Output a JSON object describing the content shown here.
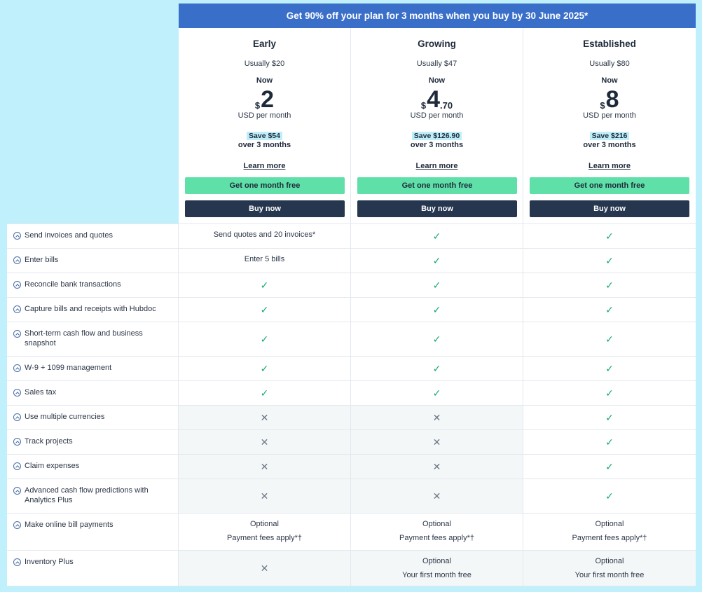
{
  "banner": "Get 90% off your plan for 3 months when you buy by 30 June 2025*",
  "plans": [
    {
      "name": "Early",
      "usually": "Usually $20",
      "now": "Now",
      "currency": "$",
      "price": "2",
      "cents": "",
      "usd": "USD per month",
      "save": "Save $54",
      "over": "over 3 months",
      "learn": "Learn more",
      "free_btn": "Get one month free",
      "buy_btn": "Buy now"
    },
    {
      "name": "Growing",
      "usually": "Usually $47",
      "now": "Now",
      "currency": "$",
      "price": "4",
      "cents": ".70",
      "usd": "USD per month",
      "save": "Save $126.90",
      "over": "over 3 months",
      "learn": "Learn more",
      "free_btn": "Get one month free",
      "buy_btn": "Buy now"
    },
    {
      "name": "Established",
      "usually": "Usually $80",
      "now": "Now",
      "currency": "$",
      "price": "8",
      "cents": "",
      "usd": "USD per month",
      "save": "Save $216",
      "over": "over 3 months",
      "learn": "Learn more",
      "free_btn": "Get one month free",
      "buy_btn": "Buy now"
    }
  ],
  "features": [
    {
      "label": "Send invoices and quotes",
      "cells": [
        {
          "t": "text",
          "v": "Send quotes and 20 invoices*"
        },
        {
          "t": "check"
        },
        {
          "t": "check"
        }
      ]
    },
    {
      "label": "Enter bills",
      "cells": [
        {
          "t": "text",
          "v": "Enter 5 bills"
        },
        {
          "t": "check"
        },
        {
          "t": "check"
        }
      ]
    },
    {
      "label": "Reconcile bank transactions",
      "cells": [
        {
          "t": "check"
        },
        {
          "t": "check"
        },
        {
          "t": "check"
        }
      ]
    },
    {
      "label": "Capture bills and receipts with Hubdoc",
      "cells": [
        {
          "t": "check"
        },
        {
          "t": "check"
        },
        {
          "t": "check"
        }
      ]
    },
    {
      "label": "Short-term cash flow and business snapshot",
      "cells": [
        {
          "t": "check"
        },
        {
          "t": "check"
        },
        {
          "t": "check"
        }
      ]
    },
    {
      "label": "W-9 + 1099 management",
      "cells": [
        {
          "t": "check"
        },
        {
          "t": "check"
        },
        {
          "t": "check"
        }
      ]
    },
    {
      "label": "Sales tax",
      "cells": [
        {
          "t": "check"
        },
        {
          "t": "check"
        },
        {
          "t": "check"
        }
      ]
    },
    {
      "label": "Use multiple currencies",
      "cells": [
        {
          "t": "cross"
        },
        {
          "t": "cross"
        },
        {
          "t": "check"
        }
      ]
    },
    {
      "label": "Track projects",
      "cells": [
        {
          "t": "cross"
        },
        {
          "t": "cross"
        },
        {
          "t": "check"
        }
      ]
    },
    {
      "label": "Claim expenses",
      "cells": [
        {
          "t": "cross"
        },
        {
          "t": "cross"
        },
        {
          "t": "check"
        }
      ]
    },
    {
      "label": "Advanced cash flow predictions with Analytics Plus",
      "cells": [
        {
          "t": "cross"
        },
        {
          "t": "cross"
        },
        {
          "t": "check"
        }
      ]
    },
    {
      "label": "Make online bill payments",
      "cells": [
        {
          "t": "two",
          "v": "Optional",
          "v2": "Payment fees apply*†"
        },
        {
          "t": "two",
          "v": "Optional",
          "v2": "Payment fees apply*†"
        },
        {
          "t": "two",
          "v": "Optional",
          "v2": "Payment fees apply*†"
        }
      ]
    },
    {
      "label": "Inventory Plus",
      "cells": [
        {
          "t": "cross"
        },
        {
          "t": "two",
          "v": "Optional",
          "v2": "Your first month free"
        },
        {
          "t": "two",
          "v": "Optional",
          "v2": "Your first month free"
        }
      ]
    }
  ],
  "icons": {
    "check": "✓",
    "cross": "✕",
    "row_toggle": "chevron-up-circle-icon"
  },
  "colors": {
    "background": "#c0f0fb",
    "banner": "#3a6fc9",
    "free_button": "#5fe0a8",
    "buy_button": "#26364f",
    "check": "#13a86b"
  }
}
